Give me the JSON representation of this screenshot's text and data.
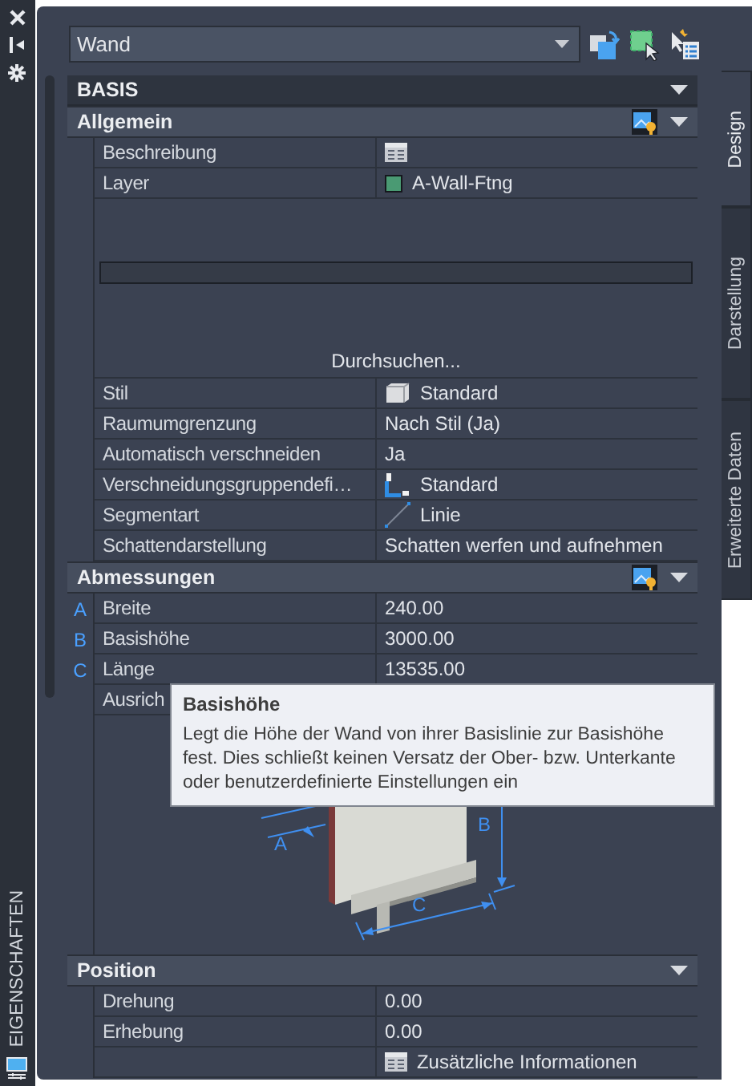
{
  "panel": {
    "title": "EIGENSCHAFTEN"
  },
  "object_dropdown": {
    "value": "Wand"
  },
  "tabs": [
    {
      "label": "Design",
      "selected": true
    },
    {
      "label": "Darstellung",
      "selected": false
    },
    {
      "label": "Erweiterte Daten",
      "selected": false
    }
  ],
  "category": {
    "title": "BASIS",
    "expanded": true
  },
  "groups": [
    {
      "title": "Allgemein",
      "expanded": true,
      "image_button": true,
      "rows": [
        {
          "kind": "list",
          "label": "Beschreibung"
        },
        {
          "kind": "swatch",
          "label": "Layer",
          "value": "A-Wall-Ftng",
          "color": "#4a9a73"
        },
        {
          "kind": "preview",
          "link": "Durchsuchen..."
        },
        {
          "kind": "style",
          "label": "Stil",
          "value": "Standard"
        },
        {
          "kind": "property",
          "label": "Raumumgrenzung",
          "value": "Nach Stil (Ja)"
        },
        {
          "kind": "property",
          "label": "Automatisch verschneiden",
          "value": "Ja"
        },
        {
          "kind": "cleanup",
          "label": "Verschneidungsgruppendefi…",
          "value": "Standard"
        },
        {
          "kind": "line",
          "label": "Segmentart",
          "value": "Linie"
        },
        {
          "kind": "property",
          "label": "Schattendarstellung",
          "value": "Schatten werfen und aufnehmen"
        }
      ]
    },
    {
      "title": "Abmessungen",
      "expanded": true,
      "image_button": true,
      "rows": [
        {
          "kind": "property",
          "marker": "A",
          "label": "Breite",
          "value": "240.00"
        },
        {
          "kind": "property",
          "marker": "B",
          "label": "Basishöhe",
          "value": "3000.00"
        },
        {
          "kind": "property",
          "marker": "C",
          "label": "Länge",
          "value": "13535.00"
        },
        {
          "kind": "property",
          "label": "Ausrich"
        },
        {
          "kind": "diagram",
          "labels": [
            "A",
            "B",
            "C"
          ]
        }
      ]
    },
    {
      "title": "Position",
      "expanded": true,
      "image_button": false,
      "rows": [
        {
          "kind": "property",
          "label": "Drehung",
          "value": "0.00"
        },
        {
          "kind": "property",
          "label": "Erhebung",
          "value": "0.00"
        },
        {
          "kind": "list",
          "value": "Zusätzliche Informationen"
        }
      ]
    }
  ],
  "tooltip": {
    "title": "Basishöhe",
    "text": "Legt die Höhe der Wand von ihrer Basislinie zur Basishöhe fest. Dies schließt keinen Versatz der Ober- bzw. Unterkante oder benutzerdefinierte Einstellungen ein"
  }
}
